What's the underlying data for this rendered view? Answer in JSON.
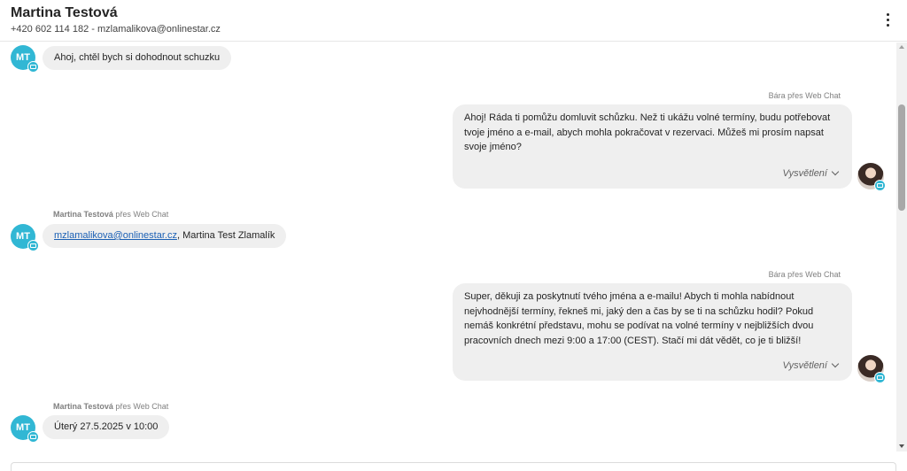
{
  "header": {
    "name": "Martina Testová",
    "info": "+420 602 114 182 - mzlamalikova@onlinestar.cz"
  },
  "messages": [
    {
      "side": "in",
      "initials": "MT",
      "text": "Ahoj, chtěl bych si dohodnout schuzku"
    },
    {
      "side": "out",
      "sender_name": "Bára",
      "sender_via": "přes Web Chat",
      "text": "Ahoj! Ráda ti pomůžu domluvit schůzku. Než ti ukážu volné termíny, budu potřebovat tvoje jméno a e-mail, abych mohla pokračovat v rezervaci. Můžeš mi prosím napsat svoje jméno?",
      "explain": "Vysvětlení"
    },
    {
      "side": "in",
      "initials": "MT",
      "sender_name": "Martina Testová",
      "sender_via": "přes Web Chat",
      "link": "mzlamalikova@onlinestar.cz",
      "text": ", Martina Test Zlamalík"
    },
    {
      "side": "out",
      "sender_name": "Bára",
      "sender_via": "přes Web Chat",
      "text": "Super, děkuji za poskytnutí tvého jména a e-mailu! Abych ti mohla nabídnout nejvhodnější termíny, řekneš mi, jaký den a čas by se ti na schůzku hodil? Pokud nemáš konkrétní představu, mohu se podívat na volné termíny v nejbližších dvou pracovních dnech mezi 9:00 a 17:00 (CEST). Stačí mi dát vědět, co je ti bližší!",
      "explain": "Vysvětlení"
    },
    {
      "side": "in",
      "initials": "MT",
      "sender_name": "Martina Testová",
      "sender_via": "přes Web Chat",
      "text": "Úterý 27.5.2025 v 10:00"
    }
  ],
  "colors": {
    "accent": "#31b7d4",
    "bubble": "#efefef",
    "link": "#1a5fb4"
  },
  "icons": {
    "more": "more-vertical-icon",
    "channel": "webchat-icon",
    "expand": "chevron-down-icon"
  }
}
